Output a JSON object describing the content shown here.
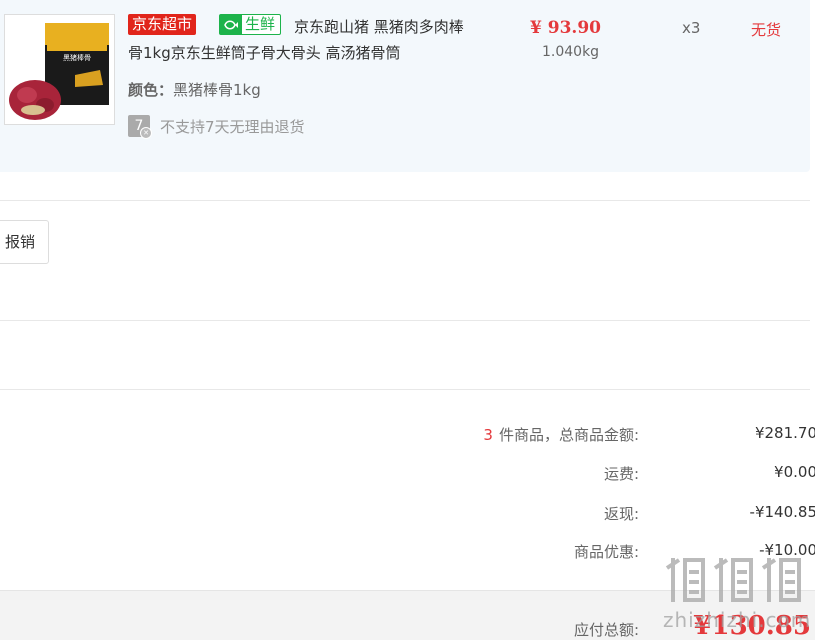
{
  "product": {
    "tag_supermarket": "京东超市",
    "tag_fresh": "生鲜",
    "title": "京东跑山猪 黑猪肉多肉棒骨1kg京东生鲜筒子骨大骨头 高汤猪骨筒",
    "price": "¥ 93.90",
    "weight": "1.040kg",
    "quantity": "x3",
    "stock_status": "无货",
    "color_label": "颜色：",
    "color_value": "黑猪棒骨1kg",
    "return_icon_text": "7",
    "return_policy": "不支持7天无理由退货",
    "package_text": "黑猪棒骨"
  },
  "actions": {
    "expense_button": "报销"
  },
  "summary": {
    "items_count": "3",
    "items_label": "件商品，总商品金额:",
    "items_total": "¥281.70",
    "shipping_label": "运费:",
    "shipping_value": "¥0.00",
    "cashback_label": "返现:",
    "cashback_value": "-¥140.85",
    "discount_label": "商品优惠:",
    "discount_value": "-¥10.00",
    "payable_label": "应付总额:",
    "payable_value": "¥130.85"
  },
  "watermark": {
    "text": "zhizhizhi.com"
  },
  "colors": {
    "accent_red": "#e4393c",
    "fresh_green": "#1db34b",
    "panel_bg": "#f3f8fc"
  }
}
